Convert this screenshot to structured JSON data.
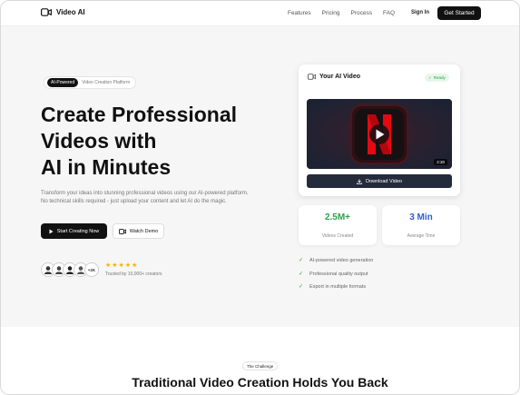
{
  "nav": {
    "logo_text": "Video AI",
    "links": [
      "Features",
      "Pricing",
      "Process",
      "FAQ"
    ],
    "signin": "Sign In",
    "get_started": "Get Started"
  },
  "hero": {
    "badge_dark": "AI-Powered",
    "badge_text": "Video Creation Platform",
    "title_lines": [
      "Create Professional",
      "Videos with",
      "AI in Minutes"
    ],
    "description": "Transform your ideas into stunning professional videos using our AI-powered platform. No technical skills required - just upload your content and let AI do the magic.",
    "primary_cta": "Start Creating Now",
    "secondary_cta": "Watch Demo",
    "avatar_count": "+2K",
    "rating_stars": 5,
    "trusted_text": "Trusted by 10,000+ creators"
  },
  "video_card": {
    "title": "Your AI Video",
    "status": "Ready",
    "duration": "2:30",
    "download_label": "Download Video"
  },
  "stats": [
    {
      "value": "2.5M+",
      "label": "Videos Created",
      "color": "#2ea148"
    },
    {
      "value": "3 Min",
      "label": "Average Time",
      "color": "#2b5fd9"
    }
  ],
  "features": [
    "AI-powered video generation",
    "Professional quality output",
    "Export in multiple formats"
  ],
  "challenge": {
    "badge": "The Challenge",
    "title": "Traditional Video Creation Holds You Back"
  },
  "icons": {
    "logo": "video-camera-icon",
    "play": "play-icon",
    "download": "download-icon",
    "check": "check-icon",
    "star": "star-icon"
  },
  "colors": {
    "primary": "#111111",
    "accent_green": "#2ea148",
    "accent_blue": "#2b5fd9",
    "star": "#f5b301",
    "netflix_red": "#e50914"
  }
}
